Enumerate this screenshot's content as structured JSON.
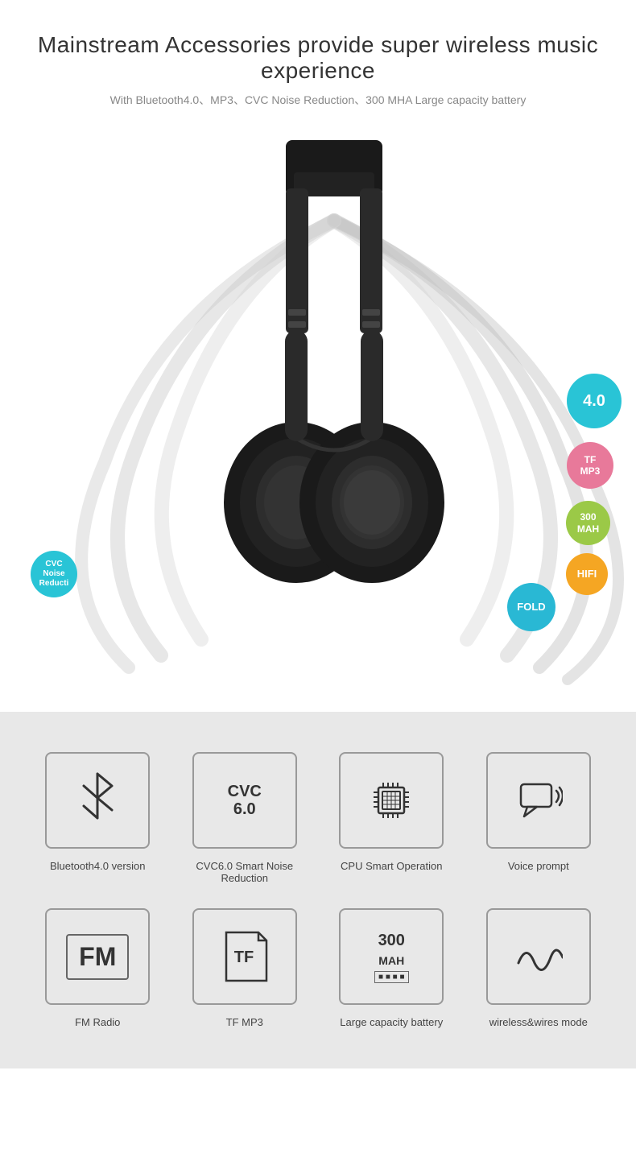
{
  "header": {
    "main_title": "Mainstream Accessories provide super wireless music experience",
    "sub_title": "With Bluetooth4.0、MP3、CVC Noise Reduction、300 MHA Large capacity battery"
  },
  "bubbles": [
    {
      "id": "bt40",
      "label": "4.0",
      "class": "bubble-40"
    },
    {
      "id": "tfmp3",
      "label": "TF\nMP3",
      "class": "bubble-tfmp3"
    },
    {
      "id": "mah",
      "label": "300\nMAH",
      "class": "bubble-300mah"
    },
    {
      "id": "hifi",
      "label": "HIFI",
      "class": "bubble-hifi"
    },
    {
      "id": "fold",
      "label": "FOLD",
      "class": "bubble-fold"
    },
    {
      "id": "cvc",
      "label": "CVC\nNoise\nReductio",
      "class": "bubble-cvc"
    }
  ],
  "features": [
    {
      "id": "bluetooth",
      "icon_type": "bluetooth",
      "label": "Bluetooth4.0 version"
    },
    {
      "id": "cvc6",
      "icon_type": "cvc",
      "label": "CVC6.0 Smart Noise Reduction"
    },
    {
      "id": "cpu",
      "icon_type": "cpu",
      "label": "CPU Smart Operation"
    },
    {
      "id": "voice",
      "icon_type": "voice",
      "label": "Voice prompt"
    },
    {
      "id": "fm",
      "icon_type": "fm",
      "label": "FM Radio"
    },
    {
      "id": "tf",
      "icon_type": "tf",
      "label": "TF MP3"
    },
    {
      "id": "battery",
      "icon_type": "battery",
      "label": "Large capacity battery"
    },
    {
      "id": "wireless",
      "icon_type": "wireless",
      "label": "wireless&wires mode"
    }
  ]
}
